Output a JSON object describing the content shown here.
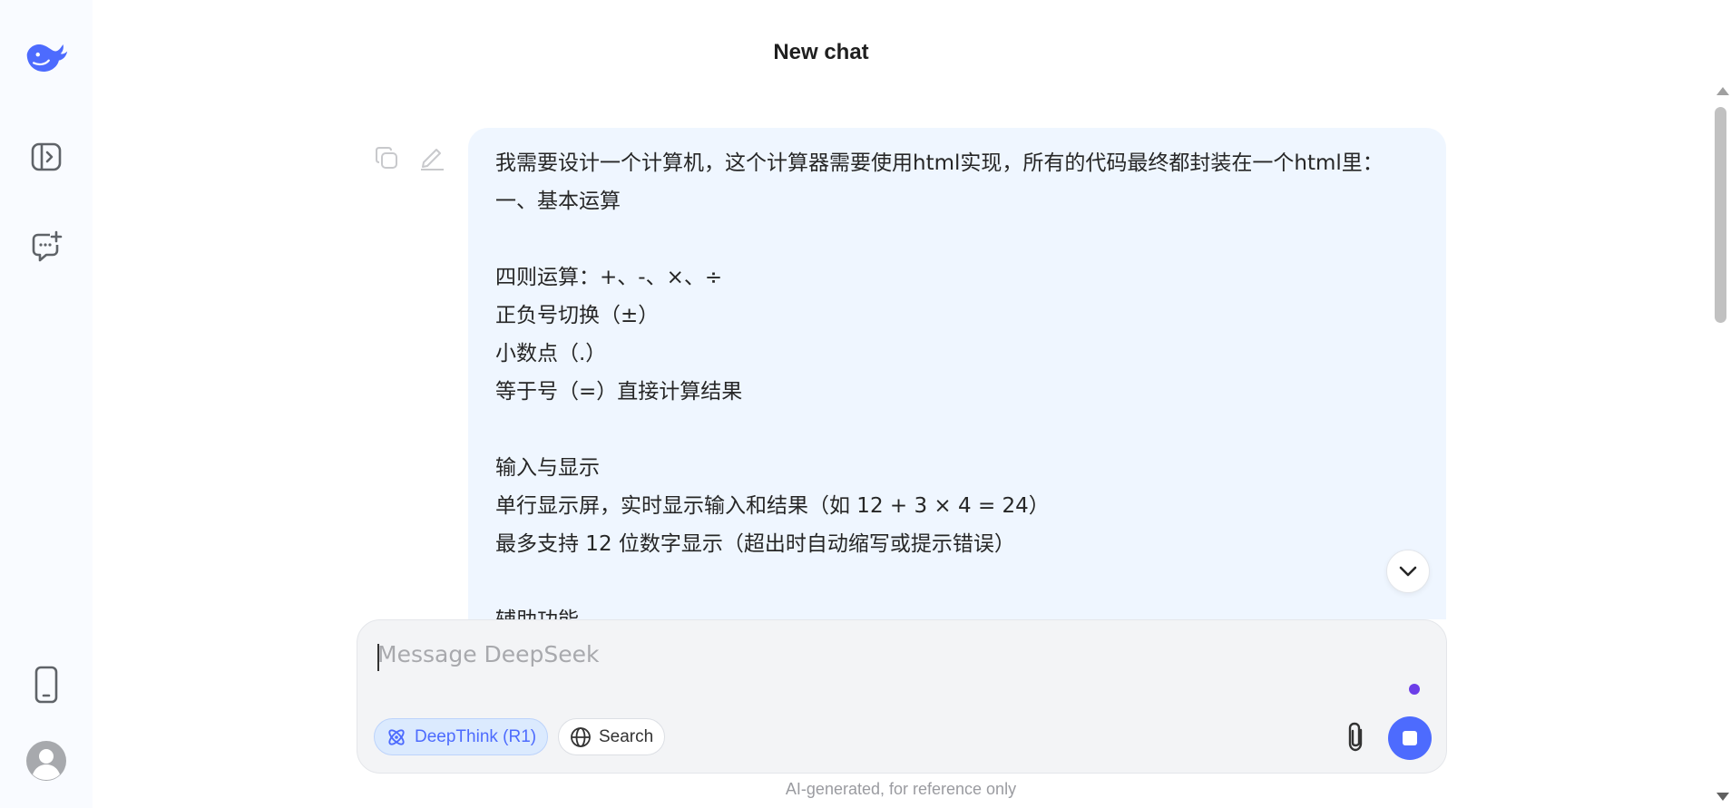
{
  "header": {
    "title": "New chat"
  },
  "sidebar": {
    "icons": [
      "deepseek-logo",
      "open-sidebar-icon",
      "new-chat-icon",
      "mobile-app-icon",
      "avatar"
    ]
  },
  "message": {
    "lines": [
      "我需要设计一个计算机，这个计算器需要使用html实现，所有的代码最终都封装在一个html里：",
      "一、基本运算",
      "",
      "四则运算：+、-、×、÷",
      "正负号切换（±）",
      "小数点（.）",
      "等于号（=）直接计算结果",
      "",
      "输入与显示",
      "单行显示屏，实时显示输入和结果（如 12 + 3 × 4 = 24）",
      "最多支持 12 位数字显示（超出时自动缩写或提示错误）",
      "",
      "辅助功能"
    ]
  },
  "composer": {
    "placeholder": "Message DeepSeek",
    "deepthink_label": "DeepThink (R1)",
    "search_label": "Search"
  },
  "footer": {
    "note": "AI-generated, for reference only"
  },
  "colors": {
    "accent": "#4d6bfe",
    "bubble": "#eff6ff",
    "sidebar": "#f9fbff"
  }
}
